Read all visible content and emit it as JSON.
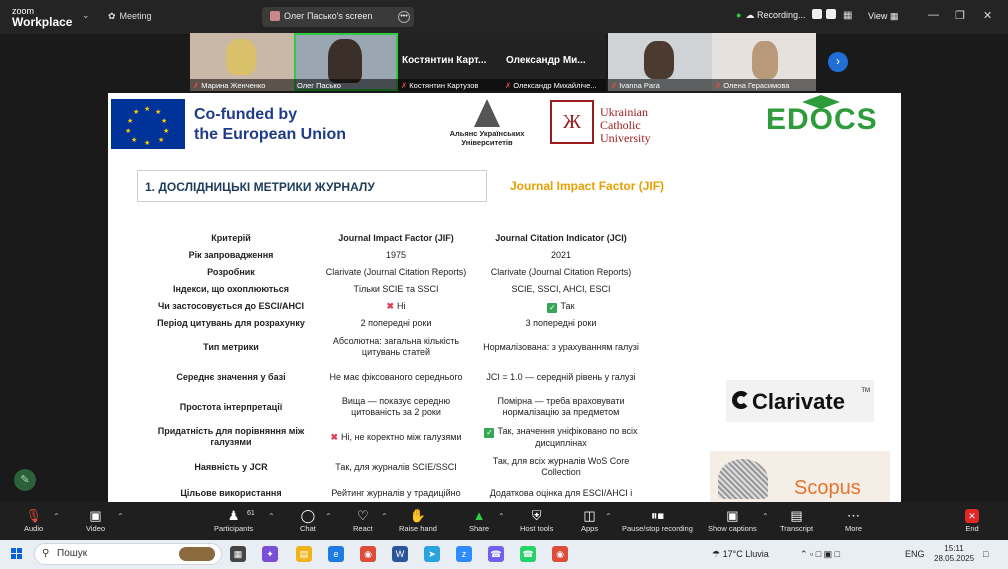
{
  "app": {
    "logo_line1": "zoom",
    "logo_line2": "Workplace",
    "meeting_label": "Meeting",
    "screen_share_label": "Олег Пасько's screen",
    "recording_label": "Recording...",
    "view_label": "View"
  },
  "participants": [
    {
      "name": "Марина Женченко",
      "video": true
    },
    {
      "name": "Олег Пасько",
      "video": true,
      "active": true
    },
    {
      "name": "Костянтин Картузов",
      "video": false,
      "display": "Костянтин Карт..."
    },
    {
      "name": "Олександр Михайліче...",
      "video": false,
      "display": "Олександр Ми..."
    },
    {
      "name": "Ivanna Para",
      "video": true
    },
    {
      "name": "Олена Герасимова",
      "video": true
    }
  ],
  "slide": {
    "cofunded_line1": "Co-funded by",
    "cofunded_line2": "the European Union",
    "alliance_line1": "Альянс Українських",
    "alliance_line2": "Університетів",
    "ucu_line1": "Ukrainian",
    "ucu_line2": "Catholic",
    "ucu_line3": "University",
    "edocs_logo": "EDOCS",
    "section_title": "1.  ДОСЛІДНИЦЬКІ МЕТРИКИ ЖУРНАЛУ",
    "jif_heading": "Journal Impact Factor (JIF)",
    "clarivate_logo": "Clarivate",
    "clarivate_tm": "TM",
    "scopus_logo": "Scopus",
    "table": {
      "headers": [
        "Критерій",
        "Journal Impact Factor (JIF)",
        "Journal Citation Indicator (JCI)"
      ],
      "rows": [
        {
          "k": "Рік запровадження",
          "a": "1975",
          "b": "2021"
        },
        {
          "k": "Розробник",
          "a": "Clarivate (Journal Citation Reports)",
          "b": "Clarivate (Journal Citation Reports)"
        },
        {
          "k": "Індекси, що охоплюються",
          "a": "Тільки SCIE та SSCI",
          "b": "SCIE, SSCI, AHCI, ESCI"
        },
        {
          "k": "Чи застосовується до ESCI/AHCI",
          "a": "Ні",
          "b": "Так"
        },
        {
          "k": "Період цитувань для розрахунку",
          "a": "2 попередні роки",
          "b": "3 попередні роки"
        },
        {
          "k": "Тип метрики",
          "a": "Абсолютна: загальна кількість цитувань статей",
          "b": "Нормалізована: з урахуванням галузі"
        },
        {
          "k": "Середнє значення у базі",
          "a": "Не має фіксованого середнього",
          "b": "JCI = 1.0 — середній рівень у галузі"
        },
        {
          "k": "Простота інтерпретації",
          "a": "Вища — показує середню цитованість за 2 роки",
          "b": "Помірна — треба враховувати нормалізацію за предметом"
        },
        {
          "k": "Придатність для порівняння між галузями",
          "a": "Ні, не коректно між галузями",
          "b": "Так, значення уніфіковано по всіх дисциплінах"
        },
        {
          "k": "Наявність у JCR",
          "a": "Так, для журналів SCIE/SSCI",
          "b": "Так, для всіх журналів WoS Core Collection"
        },
        {
          "k": "Цільове використання",
          "a": "Рейтинг журналів у традиційно",
          "b": "Додаткова оцінка для ESCI/AHCI і"
        }
      ]
    }
  },
  "toolbar": {
    "audio": "Audio",
    "video": "Video",
    "participants": "Participants",
    "participants_count": "61",
    "chat": "Chat",
    "react": "React",
    "raise_hand": "Raise hand",
    "share": "Share",
    "host_tools": "Host tools",
    "apps": "Apps",
    "pause_recording": "Pause/stop recording",
    "show_captions": "Show captions",
    "transcript": "Transcript",
    "more": "More",
    "end": "End"
  },
  "taskbar": {
    "search_placeholder": "Пошук",
    "weather": "17°C  Lluvia",
    "language": "ENG",
    "time": "15:11",
    "date": "28.05.2025"
  }
}
